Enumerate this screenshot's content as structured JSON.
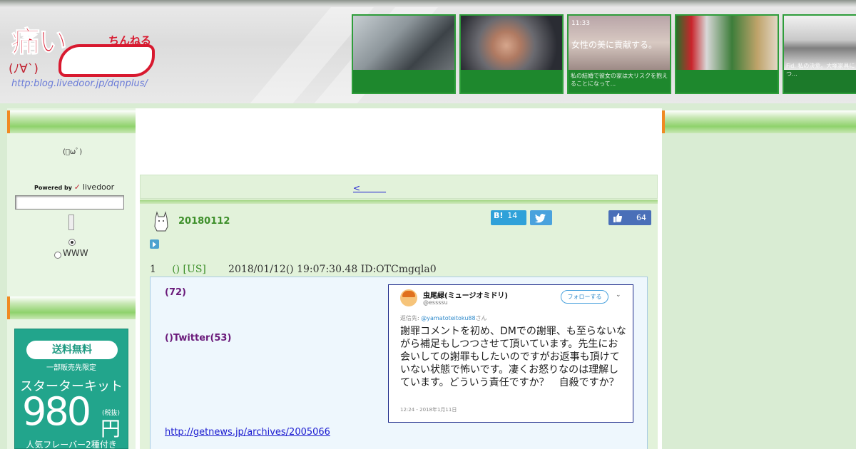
{
  "header": {
    "logo": {
      "big_text": "痛い",
      "small_text": "ちんねる",
      "face": "(ﾉ∀`)",
      "url": "http:blog.livedoor.jp/dqnplus/"
    },
    "thumbs": [
      {
        "caption": ""
      },
      {
        "caption": ""
      },
      {
        "time": "11:33",
        "caption": "女性の美に貢献する。",
        "footer": "私の結婚で彼女の家は大リスクを抱えることになって..."
      },
      {
        "caption": ""
      },
      {
        "caption": "Fid. 私の決意。大塚家具につ..."
      }
    ]
  },
  "sidebar": {
    "face": "(ﾟωﾟ)",
    "powered_by": "Powered by",
    "brand": "livedoor",
    "search_value": "",
    "search_option_www": "WWW"
  },
  "ad": {
    "free_shipping": "送料無料",
    "limited": "一部販売先限定",
    "kit": "スターターキット",
    "price": "980",
    "tax": "(税抜)",
    "yen": "円",
    "flavor": "人気フレーバー2種付き"
  },
  "main": {
    "nav_prev": "<　　　",
    "article": {
      "date": "20180112",
      "hatena_label": "B!",
      "hatena_count": "14",
      "fb_count": "64",
      "post_num": "1",
      "post_name": "() [US]",
      "post_datetime": "2018/01/12() 19:07:30.48 ID:OTCmgqla0",
      "body_line1": "(72)",
      "body_line2": "()Twitter(53)",
      "source_link": "http://getnews.jp/archives/2005066"
    }
  },
  "tweet": {
    "name": "虫尾緑(ミュージオミドリ)",
    "handle": "@essssu",
    "follow_label": "フォローする",
    "reply_prefix": "返信先:",
    "reply_to": "@yamatoteitoku88",
    "reply_suffix": "さん",
    "text": "謝罪コメントを初め、DMでの謝罪、も至らないながら補足もしつつさせて頂いています。先生にお会いしての謝罪もしたいのですがお返事も頂けていない状態で怖いです。凄くお怒りなのは理解しています。どういう責任ですか？　自殺ですか？",
    "time": "12:24 - 2018年1月11日"
  },
  "colors": {
    "accent_green": "#3d8f2a",
    "link_blue": "#1a1ad0",
    "purple_text": "#6a1a7a",
    "hatena": "#2fa1d9",
    "facebook": "#4a6fb8"
  }
}
